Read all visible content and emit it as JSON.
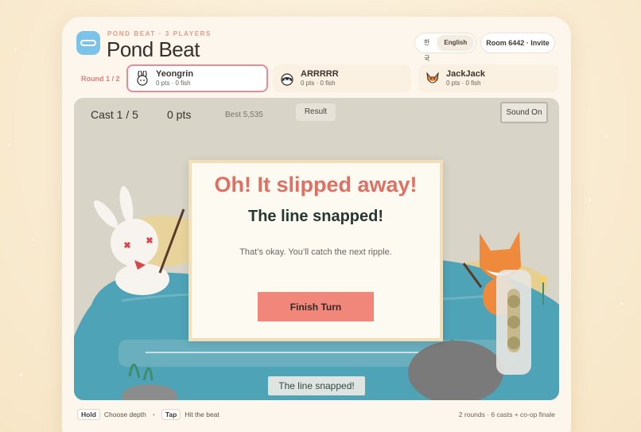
{
  "header": {
    "kicker": "POND BEAT · 3 PLAYERS",
    "title": "Pond Beat",
    "lang_ko": "한국어",
    "lang_en": "English",
    "room": "Room 6442 · Invite"
  },
  "round_label": "Round 1 / 2",
  "players": [
    {
      "name": "Yeongrin",
      "stats": "0 pts · 0 fish",
      "avatar": "rabbit-icon",
      "active": true
    },
    {
      "name": "ARRRRR",
      "stats": "0 pts · 0 fish",
      "avatar": "raccoon-icon",
      "active": false
    },
    {
      "name": "JackJack",
      "stats": "0 pts · 0 fish",
      "avatar": "fox-icon",
      "active": false
    }
  ],
  "game": {
    "cast": "Cast 1 / 5",
    "points": "0 pts",
    "best": "Best 5,535",
    "result_button": "Result",
    "sound_button": "Sound On",
    "status": "The line snapped!"
  },
  "dialog": {
    "heading": "Oh! It slipped away!",
    "subheading": "The line snapped!",
    "message": "That’s okay. You’ll catch the next ripple.",
    "button": "Finish Turn"
  },
  "footer": {
    "hold_key": "Hold",
    "hold_text": "Choose depth",
    "tap_key": "Tap",
    "tap_text": "Hit the beat",
    "summary": "2 rounds · 6 casts + co-op finale"
  },
  "colors": {
    "accent": "#eb8a92",
    "primary_button": "#f1877a",
    "water": "#4fa3b6"
  }
}
